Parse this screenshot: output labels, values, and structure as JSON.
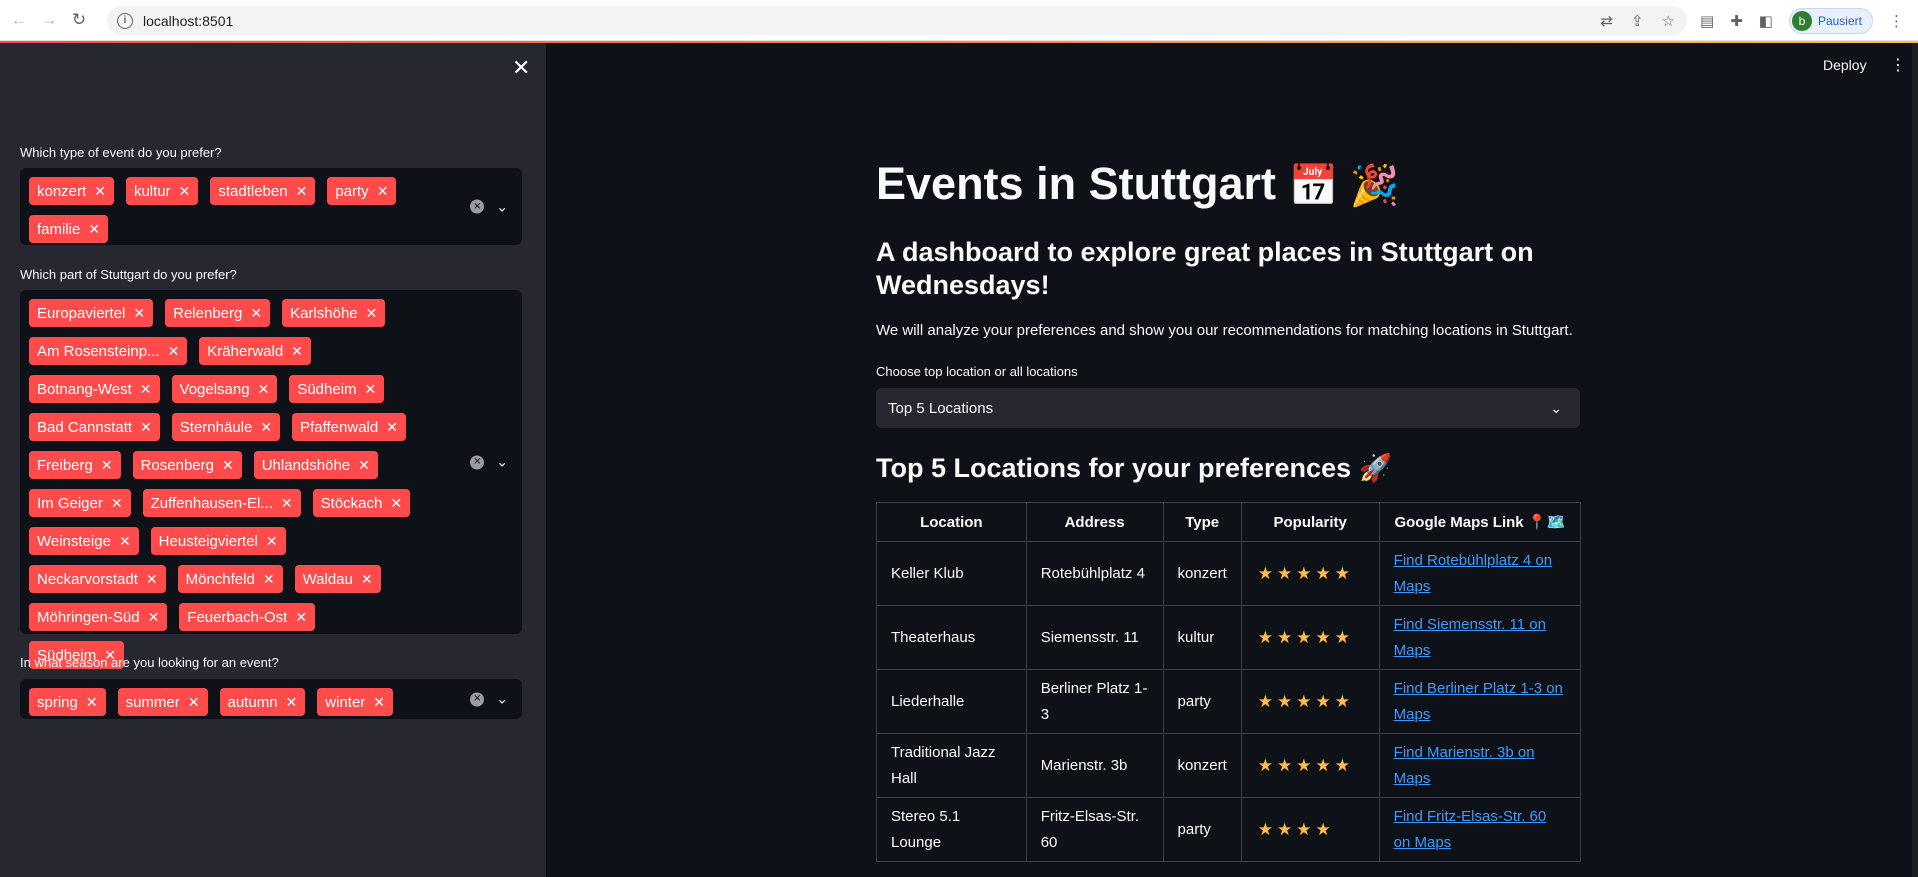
{
  "browser": {
    "url": "localhost:8501",
    "profile_initial": "b",
    "profile_label": "Pausiert"
  },
  "sidebar": {
    "event_type": {
      "label": "Which type of event do you prefer?",
      "tags": [
        "konzert",
        "kultur",
        "stadtleben",
        "party",
        "familie"
      ]
    },
    "district": {
      "label": "Which part of Stuttgart do you prefer?",
      "tags": [
        "Europaviertel",
        "Relenberg",
        "Karlshöhe",
        "Am Rosensteinp...",
        "Kräherwald",
        "Botnang-West",
        "Vogelsang",
        "Südheim",
        "Bad Cannstatt",
        "Sternhäule",
        "Pfaffenwald",
        "Freiberg",
        "Rosenberg",
        "Uhlandshöhe",
        "Im Geiger",
        "Zuffenhausen-El...",
        "Stöckach",
        "Weinsteige",
        "Heusteigviertel",
        "Neckarvorstadt",
        "Mönchfeld",
        "Waldau",
        "Möhringen-Süd",
        "Feuerbach-Ost",
        "Südheim"
      ]
    },
    "season": {
      "label": "In what season are you looking for an event?",
      "tags": [
        "spring",
        "summer",
        "autumn",
        "winter"
      ]
    }
  },
  "header": {
    "deploy_label": "Deploy"
  },
  "main": {
    "title": "Events in Stuttgart",
    "title_emoji": "📅 🎉",
    "subtitle": "A dashboard to explore great places in Stuttgart on Wednesdays!",
    "intro": "We will analyze your preferences and show you our recommendations for matching locations in Stuttgart.",
    "select_label": "Choose top location or all locations",
    "select_value": "Top 5 Locations",
    "section_title": "Top 5 Locations for your preferences 🚀",
    "table": {
      "headers": [
        "Location",
        "Address",
        "Type",
        "Popularity",
        "Google Maps Link 📍🗺️"
      ],
      "rows": [
        {
          "location": "Keller Klub",
          "address": "Rotebühlplatz 4",
          "type": "konzert",
          "stars": "★★★★★",
          "link": "Find Rotebühlplatz 4 on Maps"
        },
        {
          "location": "Theaterhaus",
          "address": "Siemensstr. 11",
          "type": "kultur",
          "stars": "★★★★★",
          "link": "Find Siemensstr. 11 on Maps"
        },
        {
          "location": "Liederhalle",
          "address": "Berliner Platz 1-3",
          "type": "party",
          "stars": "★★★★★",
          "link": "Find Berliner Platz 1-3 on Maps"
        },
        {
          "location": "Traditional Jazz Hall",
          "address": "Marienstr. 3b",
          "type": "konzert",
          "stars": "★★★★★",
          "link": "Find Marienstr. 3b on Maps"
        },
        {
          "location": "Stereo 5.1 Lounge",
          "address": "Fritz-Elsas-Str. 60",
          "type": "party",
          "stars": "★★★★",
          "link": "Find Fritz-Elsas-Str. 60 on Maps"
        }
      ]
    }
  }
}
